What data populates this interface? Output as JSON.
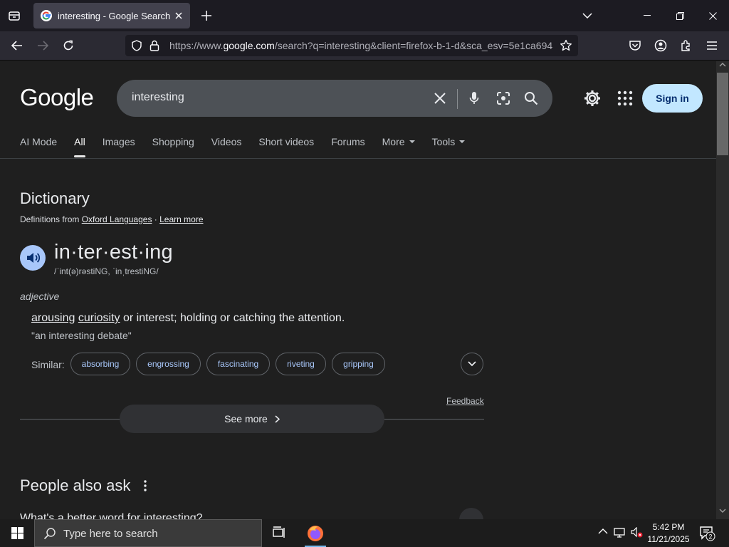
{
  "browser": {
    "tab_title": "interesting - Google Search",
    "url_prefix": "https://www.",
    "url_domain": "google.com",
    "url_rest": "/search?q=interesting&client=firefox-b-1-d&sca_esv=5e1ca694"
  },
  "google": {
    "logo": "Google",
    "query": "interesting",
    "sign_in": "Sign in",
    "nav_tabs": [
      "AI Mode",
      "All",
      "Images",
      "Shopping",
      "Videos",
      "Short videos",
      "Forums",
      "More",
      "Tools"
    ],
    "active_tab": "All"
  },
  "dictionary": {
    "heading": "Dictionary",
    "source_prefix": "Definitions from ",
    "source_name": "Oxford Languages",
    "source_sep": " · ",
    "learn_more": "Learn more",
    "word": "in·ter·est·ing",
    "pronunciation": "/ˈint(ə)rəstiNG, ˈinˌtrestiNG/",
    "part_of_speech": "adjective",
    "definition_w1": "arousing",
    "definition_w2": "curiosity",
    "definition_rest": " or interest; holding or catching the attention.",
    "definition_space": " ",
    "example": "\"an interesting debate\"",
    "similar_label": "Similar:",
    "similar": [
      "absorbing",
      "engrossing",
      "fascinating",
      "riveting",
      "gripping"
    ],
    "feedback": "Feedback",
    "see_more": "See more"
  },
  "people_also_ask": {
    "heading": "People also ask",
    "first_question": "What's a better word for interesting?"
  },
  "taskbar": {
    "search_placeholder": "Type here to search",
    "time": "5:42 PM",
    "date": "11/21/2025",
    "notifications": "2"
  },
  "colors": {
    "page_bg": "#1f1f1f",
    "chip_text": "#a8c7fa",
    "signin_bg": "#c2e7ff"
  }
}
